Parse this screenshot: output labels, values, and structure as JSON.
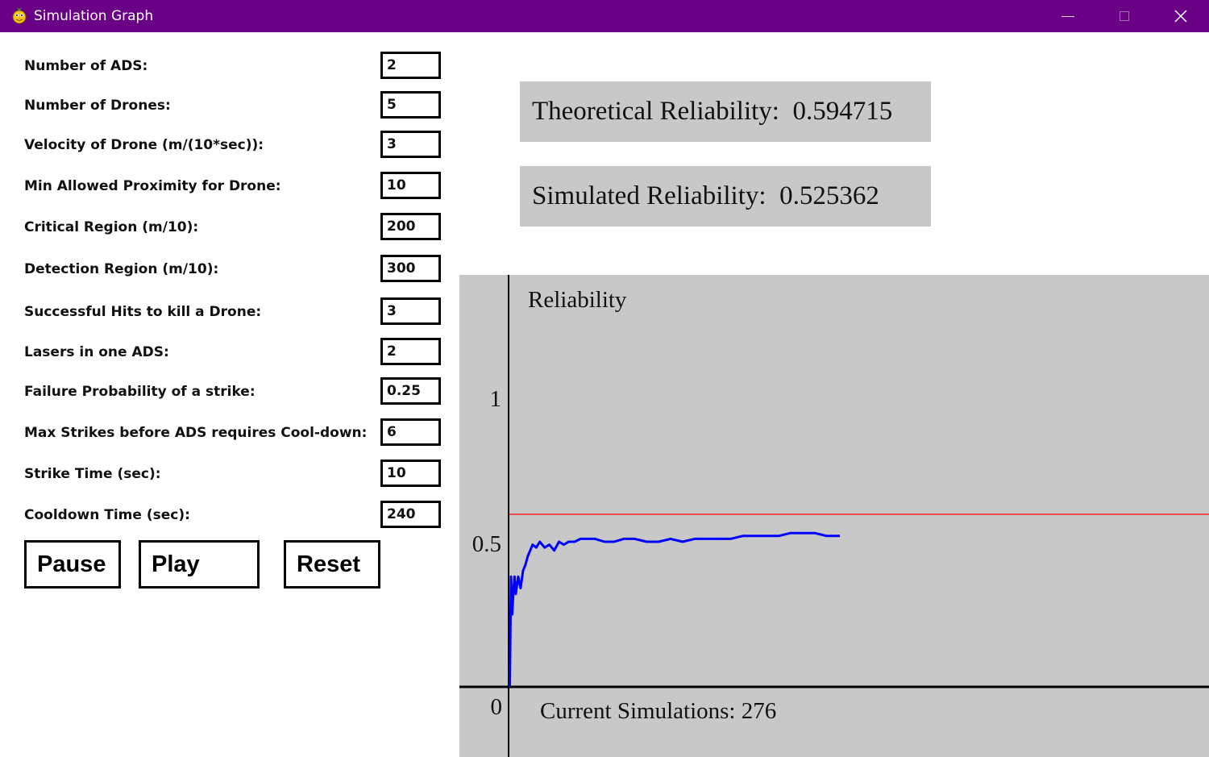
{
  "window": {
    "title": "Simulation Graph",
    "icon": "pygame-snake-icon"
  },
  "params": [
    {
      "label": "Number of ADS:",
      "value": "2"
    },
    {
      "label": "Number of Drones:",
      "value": "5"
    },
    {
      "label": "Velocity of Drone (m/(10*sec)):",
      "value": "3"
    },
    {
      "label": "Min Allowed Proximity for Drone:",
      "value": "10"
    },
    {
      "label": "Critical Region (m/10):",
      "value": "200"
    },
    {
      "label": "Detection Region (m/10):",
      "value": "300"
    },
    {
      "label": "Successful Hits to kill a Drone:",
      "value": "3"
    },
    {
      "label": "Lasers in one ADS:",
      "value": "2"
    },
    {
      "label": "Failure Probability of a strike:",
      "value": "0.25"
    },
    {
      "label": "Max Strikes before ADS requires Cool-down:",
      "value": "6"
    },
    {
      "label": "Strike Time (sec):",
      "value": "10"
    },
    {
      "label": "Cooldown Time (sec):",
      "value": "240"
    }
  ],
  "buttons": {
    "pause": "Pause",
    "play": "Play",
    "reset": "Reset"
  },
  "theoretical": {
    "label": "Theoretical Reliability:",
    "value": "0.594715"
  },
  "simulated": {
    "label": "Simulated Reliability:",
    "value": "0.525362"
  },
  "chart_data": {
    "type": "line",
    "ylabel": "Reliability",
    "y_ticks": [
      "1",
      "0.5",
      "0"
    ],
    "ylim": [
      0,
      1.2
    ],
    "xlim": [
      0,
      400
    ],
    "grid": false,
    "footer_label": "Current Simulations:",
    "current_simulations": "276",
    "reference_line": {
      "y": 0.594715,
      "color": "#ff0000"
    },
    "series": [
      {
        "color": "#0000ff",
        "x": [
          1,
          2,
          3,
          4,
          5,
          6,
          8,
          10,
          12,
          14,
          16,
          18,
          20,
          23,
          26,
          30,
          34,
          38,
          42,
          46,
          50,
          55,
          60,
          66,
          72,
          80,
          88,
          96,
          105,
          115,
          125,
          135,
          145,
          155,
          165,
          175,
          185,
          195,
          205,
          215,
          225,
          235,
          245,
          255,
          265,
          276
        ],
        "y": [
          0.0,
          0.38,
          0.25,
          0.33,
          0.38,
          0.32,
          0.38,
          0.34,
          0.4,
          0.42,
          0.45,
          0.47,
          0.49,
          0.48,
          0.5,
          0.48,
          0.49,
          0.47,
          0.5,
          0.49,
          0.5,
          0.5,
          0.51,
          0.51,
          0.51,
          0.5,
          0.5,
          0.51,
          0.51,
          0.5,
          0.5,
          0.51,
          0.5,
          0.51,
          0.51,
          0.51,
          0.51,
          0.52,
          0.52,
          0.52,
          0.52,
          0.53,
          0.53,
          0.53,
          0.52,
          0.52
        ]
      }
    ]
  }
}
